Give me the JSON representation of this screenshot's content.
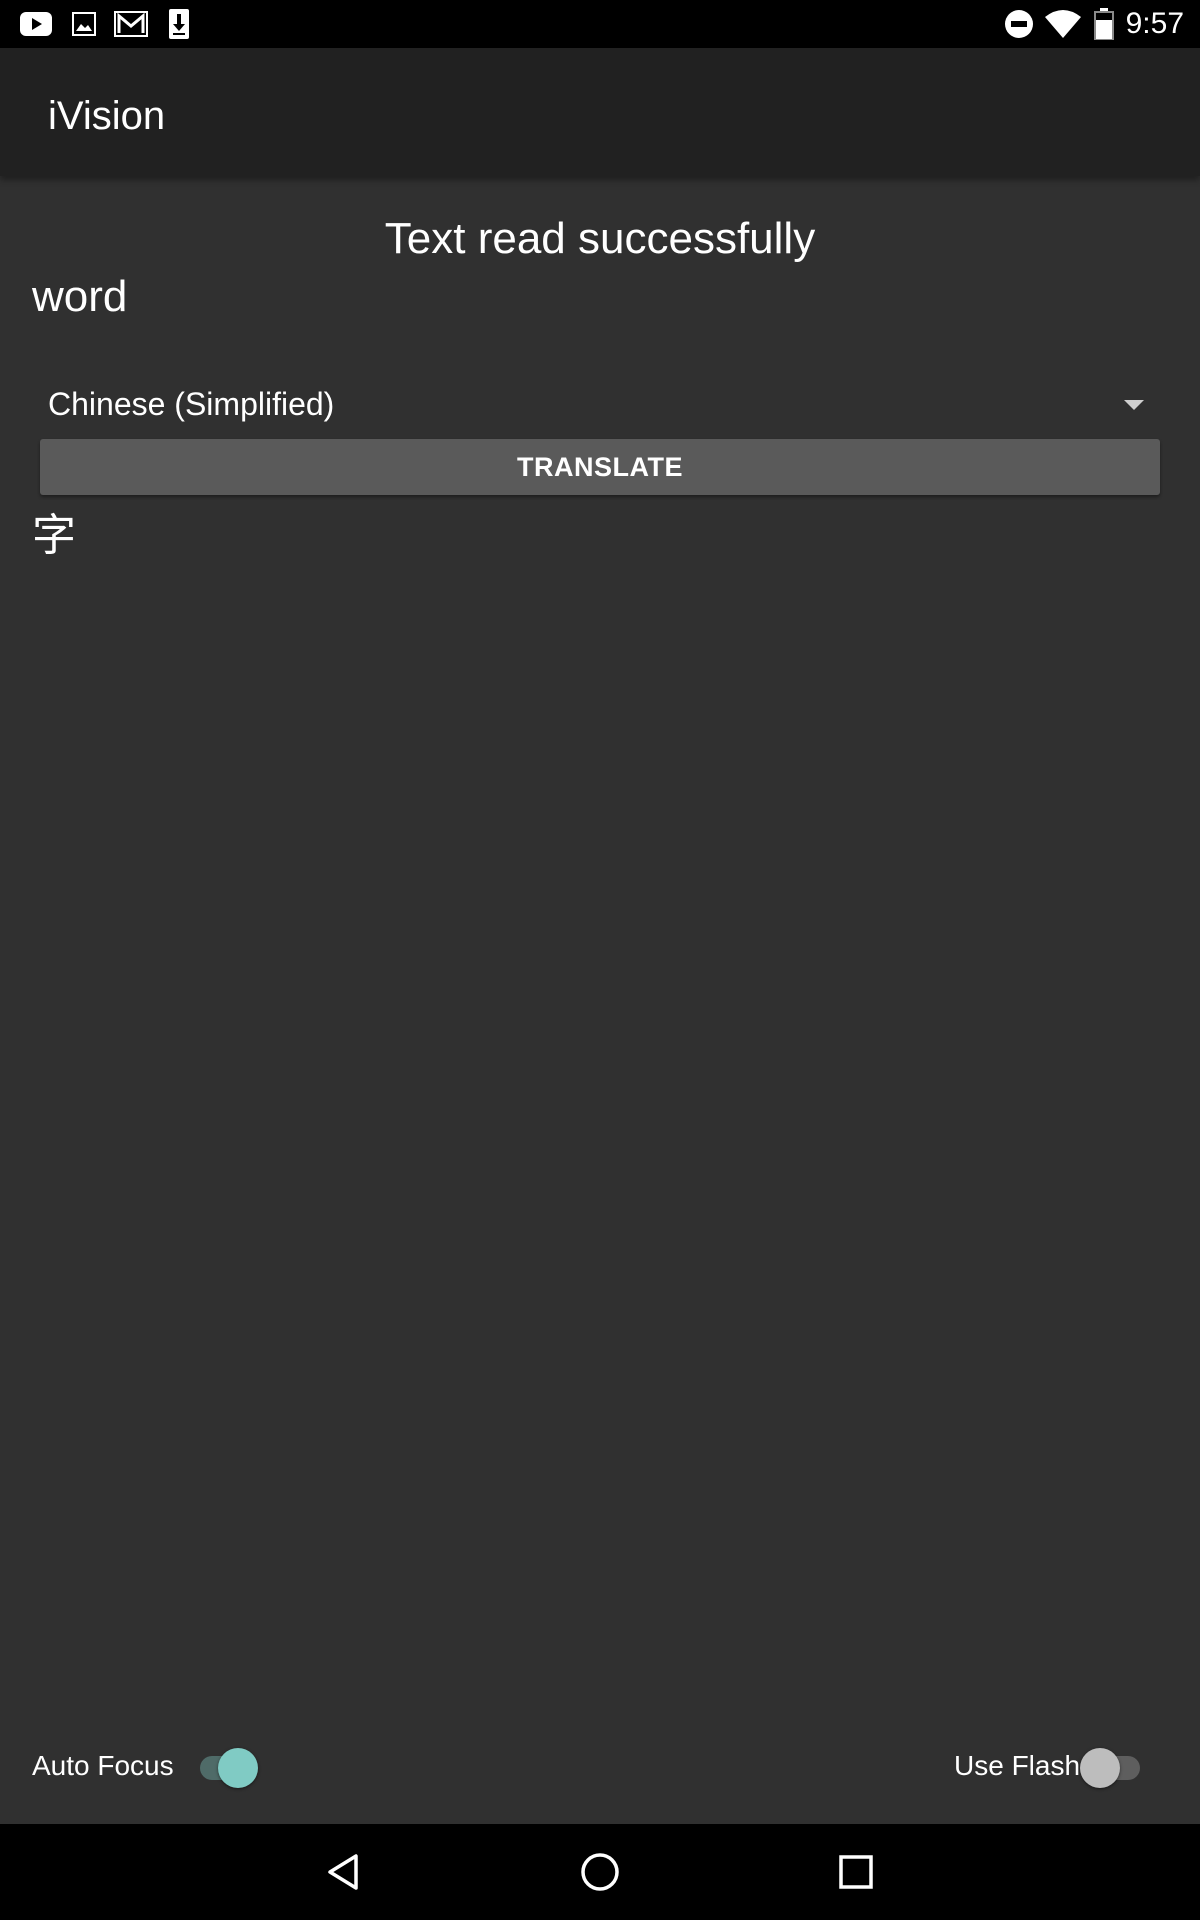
{
  "status_bar": {
    "time": "9:57",
    "left_icons": [
      "youtube-icon",
      "image-icon",
      "gmail-icon",
      "download-icon"
    ],
    "right_icons": [
      "do-not-disturb-icon",
      "wifi-icon",
      "battery-icon"
    ]
  },
  "app_bar": {
    "title": "iVision"
  },
  "main": {
    "status_message": "Text read successfully",
    "recognized_text": "word",
    "language_select": {
      "selected": "Chinese (Simplified)"
    },
    "translate_button": "TRANSLATE",
    "translated_text": "字"
  },
  "controls": {
    "auto_focus": {
      "label": "Auto Focus",
      "checked": true
    },
    "use_flash": {
      "label": "Use Flash",
      "checked": false
    }
  },
  "nav_bar": {
    "buttons": [
      "back-icon",
      "home-icon",
      "recents-icon"
    ]
  },
  "colors": {
    "background": "#303030",
    "app_bar": "#212121",
    "button": "#5a5a5a",
    "switch_on_thumb": "#80cbc4",
    "switch_on_track": "#4f6b68",
    "switch_off_thumb": "#bdbdbd",
    "switch_off_track": "#5e5e5e"
  }
}
